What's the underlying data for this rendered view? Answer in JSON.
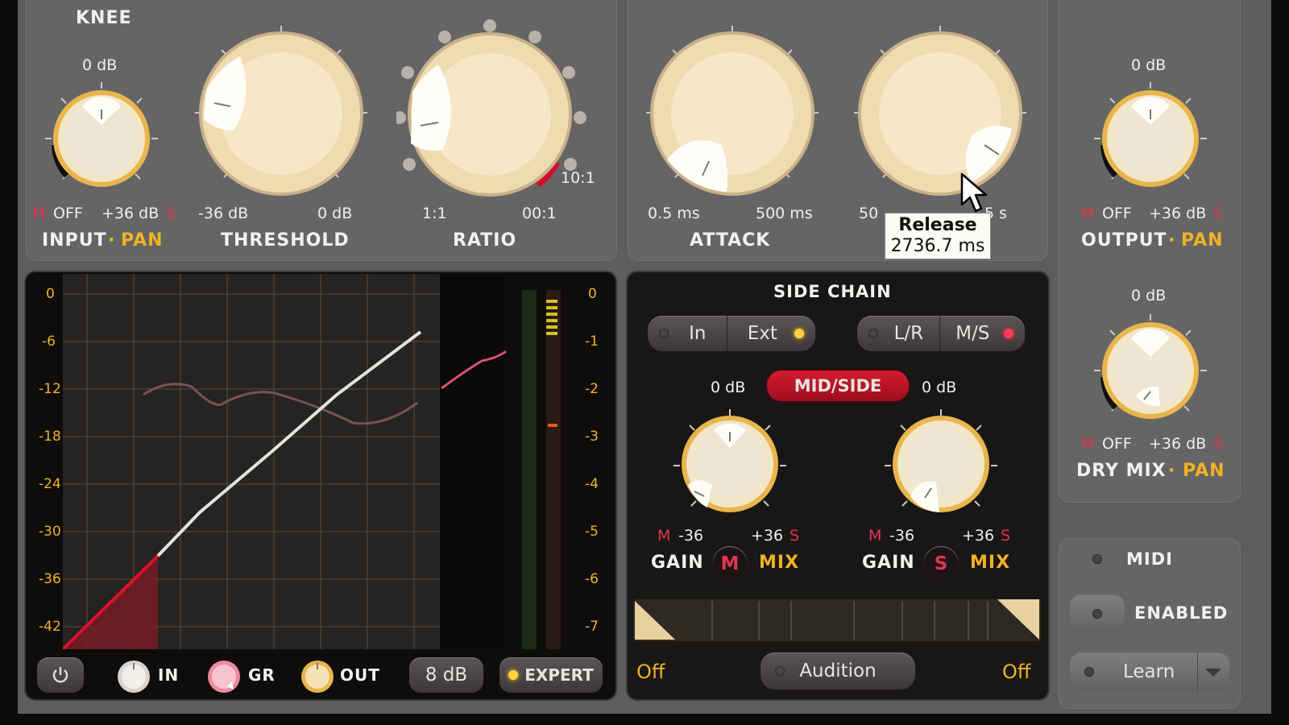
{
  "top": {
    "knee_label": "KNEE",
    "input": {
      "value": "0 dB",
      "m": "M",
      "off": "OFF",
      "max": "+36 dB",
      "s": "S",
      "label": "INPUT",
      "sep": "·",
      "pan": "PAN"
    },
    "threshold": {
      "min": "-36 dB",
      "max": "0 dB",
      "label": "THRESHOLD"
    },
    "ratio": {
      "min": "1:1",
      "max": "00:1",
      "current": "10:1",
      "label": "RATIO"
    },
    "attack": {
      "min": "0.5 ms",
      "max": "500 ms",
      "label": "ATTACK"
    },
    "release": {
      "min": "50",
      "max": "5 s"
    },
    "tooltip": {
      "title": "Release",
      "value": "2736.7 ms"
    },
    "output": {
      "value": "0 dB",
      "m": "M",
      "off": "OFF",
      "max": "+36 dB",
      "s": "S",
      "label": "OUTPUT",
      "sep": "·",
      "pan": "PAN"
    },
    "drymix": {
      "value": "0 dB",
      "m": "M",
      "off": "OFF",
      "max": "+36 dB",
      "s": "S",
      "label": "DRY MIX",
      "sep": "·",
      "pan": "PAN"
    }
  },
  "graph": {
    "left_axis": [
      "0",
      "-6",
      "-12",
      "-18",
      "-24",
      "-30",
      "-36",
      "-42"
    ],
    "right_axis": [
      "0",
      "-1",
      "-2",
      "-3",
      "-4",
      "-5",
      "-6",
      "-7"
    ],
    "colors": {
      "curve": "#e0e0dc",
      "under": "#d0102a",
      "accent": "#f0b324"
    }
  },
  "graph_footer": {
    "power_icon": "power-icon",
    "in_label": "IN",
    "gr_label": "GR",
    "out_label": "OUT",
    "range": "8 dB",
    "expert": "EXPERT"
  },
  "sidechain": {
    "title": "SIDE CHAIN",
    "in": "In",
    "ext": "Ext",
    "lr": "L/R",
    "ms": "M/S",
    "midside": "MID/SIDE",
    "left_value": "0 dB",
    "right_value": "0 dB",
    "left": {
      "m": "M",
      "min": "-36",
      "max": "+36",
      "s": "S",
      "gain": "GAIN",
      "badge": "M",
      "mix": "MIX"
    },
    "right": {
      "m": "M",
      "min": "-36",
      "max": "+36",
      "s": "S",
      "gain": "GAIN",
      "badge": "S",
      "mix": "MIX"
    },
    "off_left": "Off",
    "off_right": "Off",
    "audition": "Audition"
  },
  "midi": {
    "title": "MIDI",
    "enabled": "ENABLED",
    "learn": "Learn"
  }
}
